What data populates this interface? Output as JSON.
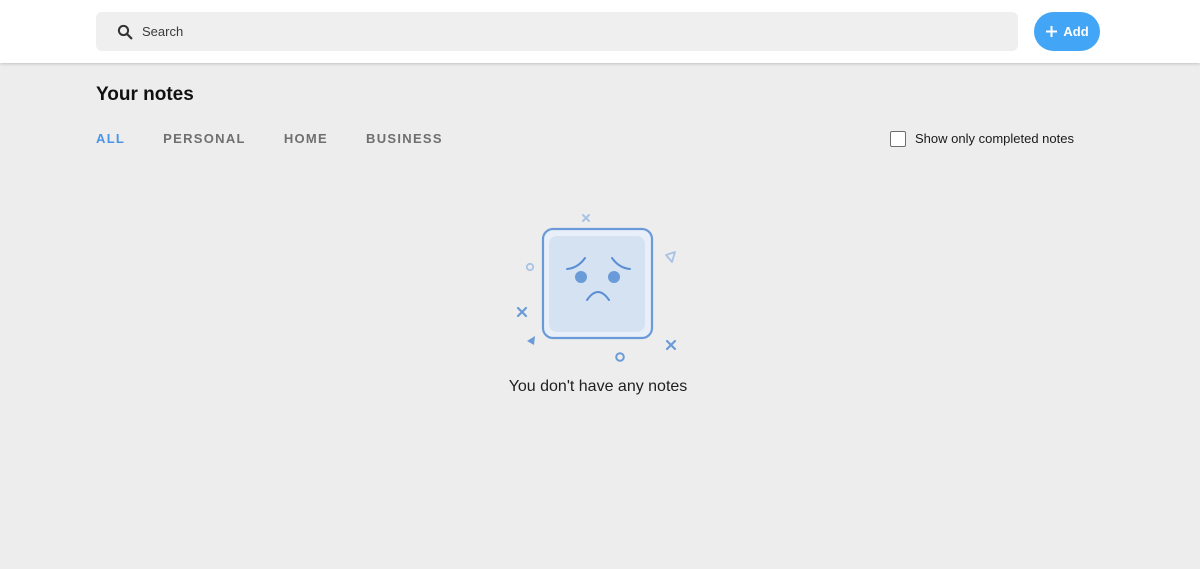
{
  "header": {
    "search": {
      "placeholder": "Search",
      "value": ""
    },
    "add_label": "Add",
    "icons": {
      "search": "search-icon",
      "add": "plus-icon"
    },
    "accent_color": "#42a5f5"
  },
  "main": {
    "title": "Your notes",
    "tabs": [
      {
        "label": "ALL",
        "active": true
      },
      {
        "label": "PERSONAL",
        "active": false
      },
      {
        "label": "HOME",
        "active": false
      },
      {
        "label": "BUSINESS",
        "active": false
      }
    ],
    "completed_filter": {
      "label": "Show only completed notes",
      "checked": false
    },
    "empty_state": {
      "message": "You don't have any notes",
      "icon": "sad-face-icon",
      "colors": {
        "stroke": "#6a9bd8",
        "fill": "#d4e2f2"
      }
    }
  }
}
